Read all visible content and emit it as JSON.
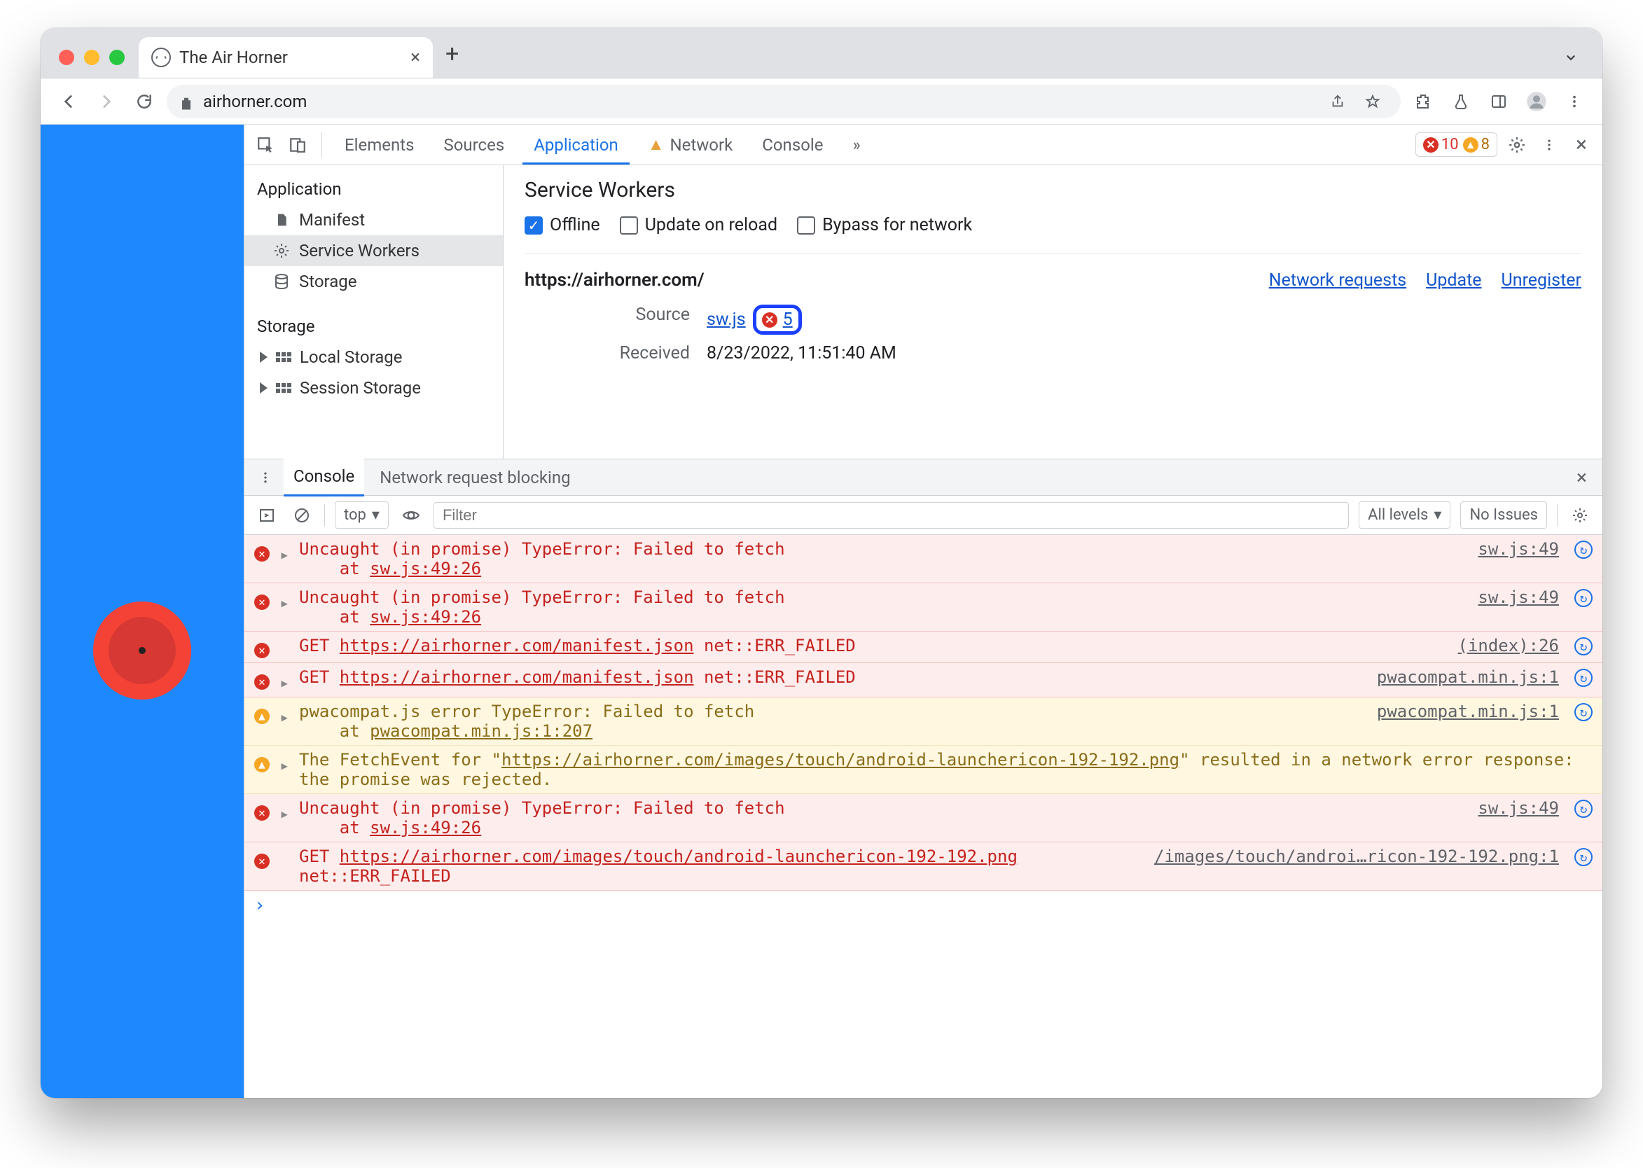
{
  "browser": {
    "tab_title": "The Air Horner",
    "url_display": "airhorner.com"
  },
  "devtools": {
    "tabs": {
      "elements": "Elements",
      "sources": "Sources",
      "application": "Application",
      "network": "Network",
      "console": "Console",
      "more": "»"
    },
    "counts": {
      "errors": "10",
      "warnings": "8"
    }
  },
  "app_panel": {
    "sidebar": {
      "application_heading": "Application",
      "manifest": "Manifest",
      "service_workers": "Service Workers",
      "storage": "Storage",
      "storage_heading": "Storage",
      "local_storage": "Local Storage",
      "session_storage": "Session Storage"
    },
    "sw": {
      "title": "Service Workers",
      "offline": "Offline",
      "update_on_reload": "Update on reload",
      "bypass": "Bypass for network",
      "origin": "https://airhorner.com/",
      "links": {
        "network_requests": "Network requests",
        "update": "Update",
        "unregister": "Unregister"
      },
      "source_label": "Source",
      "source_file": "sw.js",
      "source_errcount": "5",
      "received_label": "Received",
      "received_value": "8/23/2022, 11:51:40 AM"
    }
  },
  "drawer": {
    "console": "Console",
    "nrb": "Network request blocking"
  },
  "console_toolbar": {
    "context": "top",
    "filter_placeholder": "Filter",
    "levels": "All levels",
    "issues": "No Issues"
  },
  "console_rows": [
    {
      "type": "err",
      "expand": true,
      "msg": "Uncaught (in promise) TypeError: Failed to fetch\n    at ",
      "trace": "sw.js:49:26",
      "where": "sw.js:49"
    },
    {
      "type": "err",
      "expand": true,
      "msg": "Uncaught (in promise) TypeError: Failed to fetch\n    at ",
      "trace": "sw.js:49:26",
      "where": "sw.js:49"
    },
    {
      "type": "err",
      "expand": false,
      "prefix": "GET ",
      "url": "https://airhorner.com/manifest.json",
      "suffix": " net::ERR_FAILED",
      "where": "(index):26"
    },
    {
      "type": "err",
      "expand": true,
      "prefix": "GET ",
      "url": "https://airhorner.com/manifest.json",
      "suffix": " net::ERR_FAILED",
      "where": "pwacompat.min.js:1"
    },
    {
      "type": "warn",
      "expand": true,
      "msg": "pwacompat.js error TypeError: Failed to fetch\n    at ",
      "trace": "pwacompat.min.js:1:207",
      "where": "pwacompat.min.js:1"
    },
    {
      "type": "warn",
      "expand": true,
      "msg": "The FetchEvent for \"",
      "url": "https://airhorner.com/images/touch/android-launchericon-192-192.png",
      "suffix": "\" resulted in a network error response: the promise was rejected.",
      "where": ""
    },
    {
      "type": "err",
      "expand": true,
      "msg": "Uncaught (in promise) TypeError: Failed to fetch\n    at ",
      "trace": "sw.js:49:26",
      "where": "sw.js:49"
    },
    {
      "type": "err",
      "expand": false,
      "prefix": "GET ",
      "url": "https://airhorner.com/images/touch/android-launchericon-192-192.png",
      "suffix": " net::ERR_FAILED",
      "where": "/images/touch/androi…ricon-192-192.png:1"
    }
  ]
}
